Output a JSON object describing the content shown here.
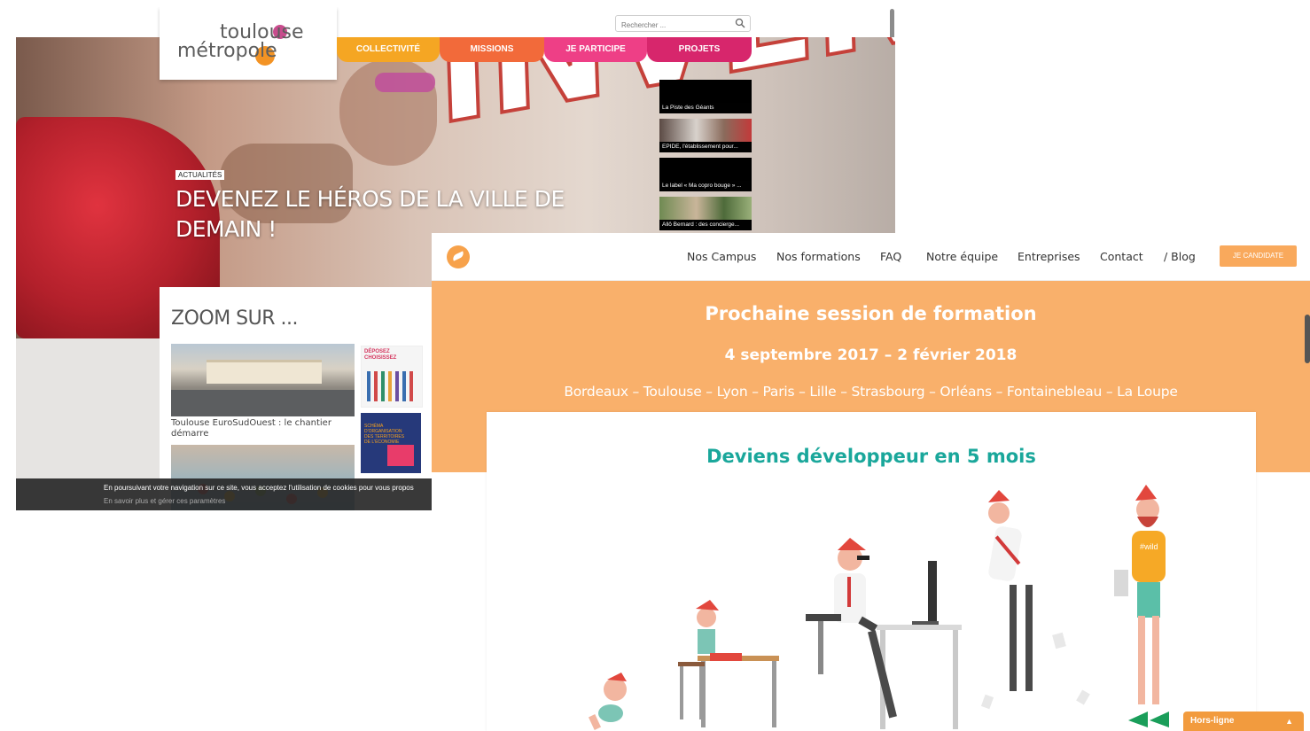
{
  "toulouse": {
    "search_placeholder": "Rechercher ...",
    "logo_line1": "toulouse",
    "logo_line2": "métropole",
    "nav": [
      "COLLECTIVITÉ",
      "MISSIONS",
      "JE PARTICIPE",
      "PROJETS"
    ],
    "thumbnails": [
      "La Piste des Géants",
      "EPIDE, l'établissement pour...",
      "Le label « Ma copro bouge » ...",
      "Allô Bernard : des concierge..."
    ],
    "hero_word": "INVENTEZ",
    "category": "ACTUALITÉS",
    "headline": "DEVENEZ LE HÉROS DE LA VILLE DE DEMAIN !",
    "zoom_title": "ZOOM SUR ...",
    "card_caption": "Toulouse EuroSudOuest : le chantier démarre",
    "side_card_1_text": "DÉPOSEZ CHOISISSEZ",
    "side_card_2_text": "SCHÉMA D'ORGANISATION DES TERRITOIRES DE L'ÉCONOMIE",
    "cookie_line1": "En poursuivant votre navigation sur ce site, vous acceptez l'utilisation de cookies pour vous propos",
    "cookie_line2": "En savoir plus et gérer ces paramètres",
    "colors": {
      "collectivite": "#f5a623",
      "missions": "#f26a3a",
      "participe": "#ee3f86",
      "projets": "#d7266c"
    }
  },
  "wild": {
    "menu": [
      "Nos Campus",
      "Nos formations",
      "FAQ",
      "Notre équipe",
      "Entreprises",
      "Contact",
      "/ Blog"
    ],
    "cta": "JE CANDIDATE",
    "title": "Prochaine session de formation",
    "dates": "4 septembre 2017 – 2 février 2018",
    "cities": "Bordeaux – Toulouse – Lyon – Paris – Lille – Strasbourg – Orléans – Fontainebleau – La Loupe",
    "card_title": "Deviens développeur en 5 mois",
    "shirt_text": "#wild",
    "status": "Hors-ligne",
    "colors": {
      "band": "#f9b06b",
      "accent": "#1aa79b",
      "status": "#f29b3e"
    }
  }
}
